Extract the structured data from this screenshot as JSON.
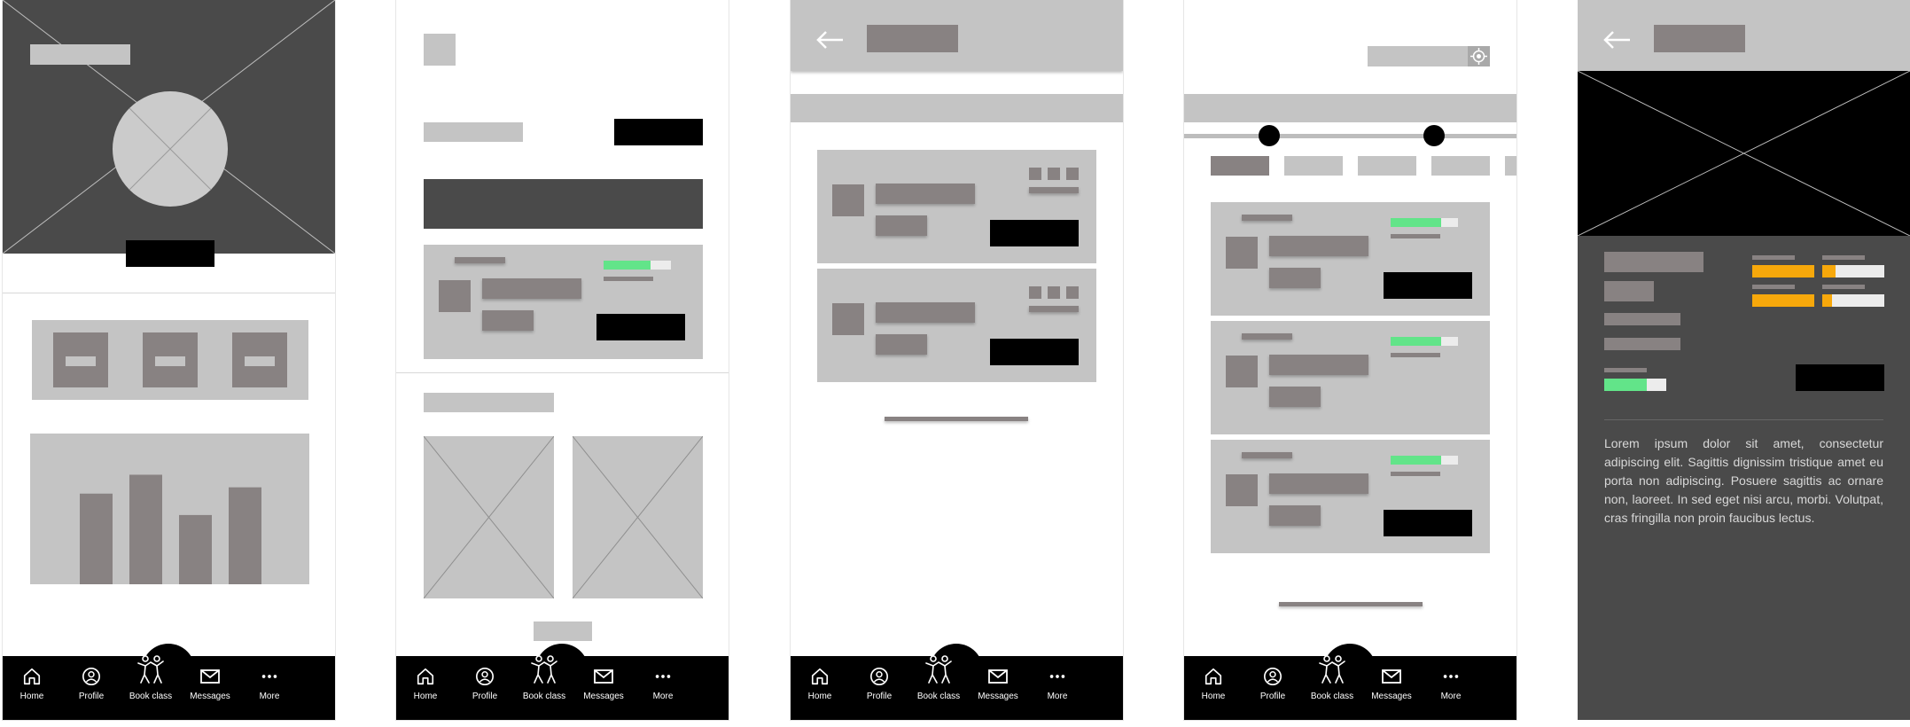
{
  "colors": {
    "placeholder_light": "#c4c4c4",
    "placeholder_mid": "#888282",
    "placeholder_dark": "#4a4a4a",
    "cta_black": "#000000",
    "progress_green": "#62e489",
    "progress_orange": "#f7a80b",
    "nav_bar": "#000000",
    "nav_text": "#ffffff"
  },
  "nav": {
    "items": [
      {
        "label": "Home",
        "icon": "home-icon"
      },
      {
        "label": "Profile",
        "icon": "profile-icon"
      },
      {
        "label": "Book class",
        "icon": "book-class-icon"
      },
      {
        "label": "Messages",
        "icon": "messages-icon"
      },
      {
        "label": "More",
        "icon": "more-icon"
      }
    ]
  },
  "screens": [
    {
      "name": "home-dashboard",
      "icons": [
        "image-placeholder-icon",
        "bar-chart-icon"
      ],
      "chart": {
        "type": "bar",
        "values": [
          0.72,
          0.87,
          0.55,
          0.77
        ]
      }
    },
    {
      "name": "class-list-screen",
      "progress": [
        0.7
      ],
      "icons": [
        "image-placeholder-icon"
      ]
    },
    {
      "name": "booking-screen",
      "icons": [
        "back-arrow-icon"
      ]
    },
    {
      "name": "schedule-filter-screen",
      "icons": [
        "location-target-icon"
      ],
      "progress": [
        0.75,
        0.75,
        0.75
      ]
    },
    {
      "name": "class-detail-screen",
      "icons": [
        "back-arrow-icon",
        "image-placeholder-icon"
      ],
      "orange_bars": [
        1.0,
        0.22,
        1.0,
        0.15
      ],
      "progress": [
        0.68
      ],
      "description": "Lorem ipsum dolor sit amet, consectetur adipiscing elit. Sagittis dignissim tristique amet eu porta non adipiscing. Posuere sagittis ac ornare non, laoreet. In sed eget nisi arcu, morbi. Volutpat, cras fringilla non proin faucibus lectus."
    }
  ]
}
